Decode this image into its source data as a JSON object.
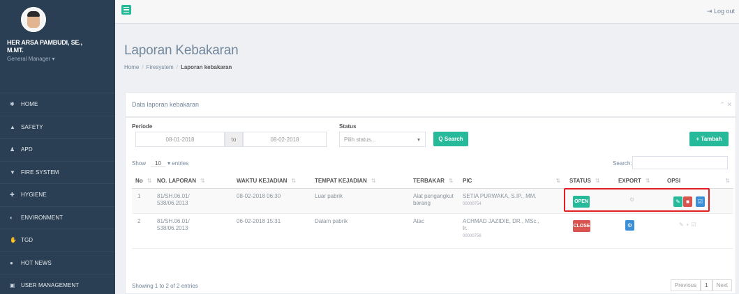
{
  "user": {
    "name_line1": "HER ARSA PAMBUDI, SE.,",
    "name_line2": "M.MT.",
    "role": "General Manager ▾"
  },
  "sidebar": {
    "items": [
      {
        "label": "Home",
        "icon": "home-icon",
        "glyph": "✱"
      },
      {
        "label": "SAFETY",
        "icon": "thumbs-up-icon",
        "glyph": "▲"
      },
      {
        "label": "APD",
        "icon": "user-icon",
        "glyph": "♟"
      },
      {
        "label": "FIRE SYSTEM",
        "icon": "fire-extinguisher-icon",
        "glyph": "▼"
      },
      {
        "label": "HYGIENE",
        "icon": "plus-icon",
        "glyph": "✚"
      },
      {
        "label": "ENVIRONMENT",
        "icon": "leaf-icon",
        "glyph": "◐"
      },
      {
        "label": "TGD",
        "icon": "hands-icon",
        "glyph": "✋"
      },
      {
        "label": "HOT NEWS",
        "icon": "globe-icon",
        "glyph": "●"
      },
      {
        "label": "USER MANAGEMENT",
        "icon": "lock-icon",
        "glyph": "▣"
      }
    ]
  },
  "topbar": {
    "logout": "Log out",
    "logout_glyph": "⇥"
  },
  "page": {
    "title": "Laporan Kebakaran",
    "breadcrumb": [
      "Home",
      "Firesystem",
      "Laporan kebakaran"
    ]
  },
  "panel": {
    "title": "Data laporan kebakaran",
    "tools": "⌃ ✕"
  },
  "filters": {
    "periode_label": "Periode",
    "date_from": "08-01-2018",
    "to_label": "to",
    "date_to": "08-02-2018",
    "status_label": "Status",
    "status_placeholder": "Pilih status...",
    "search_button": "Q Search",
    "add_button": "+ Tambah"
  },
  "table_controls": {
    "show_label": "Show",
    "show_value": "10",
    "entries_label": "▾ entries",
    "search_label": "Search:"
  },
  "table": {
    "headers": [
      "No",
      "NO. LAPORAN",
      "WAKTU KEJADIAN",
      "TEMPAT KEJADIAN",
      "TERBAKAR",
      "PIC",
      "STATUS",
      "EXPORT",
      "OPSI"
    ],
    "rows": [
      {
        "no": "1",
        "laporan_1": "81/SH.06.01/",
        "laporan_2": "538/06.2013",
        "waktu": "08-02-2018 06:30",
        "tempat": "Luar pabrik",
        "terbakar_1": "Alat pengangkut",
        "terbakar_2": "barang",
        "pic_1": "SETIA PURWAKA, S.IP., MM.",
        "pic_2": "",
        "pic_id": "00000754",
        "status": "OPEN",
        "status_color": "#26b99a"
      },
      {
        "no": "2",
        "laporan_1": "81/SH.06.01/",
        "laporan_2": "538/06.2013",
        "waktu": "06-02-2018 15:31",
        "tempat": "Dalam pabrik",
        "terbakar_1": "Atac",
        "terbakar_2": "",
        "pic_1": "ACHMAD JAZIDIE, DR., MSc.,",
        "pic_2": "Ir.",
        "pic_id": "00000756",
        "status": "CLOSE",
        "status_color": "#d9534f"
      }
    ]
  },
  "footer": {
    "info": "Showing 1 to 2 of 2 entries",
    "prev": "Previous",
    "page": "1",
    "next": "Next"
  },
  "colors": {
    "green": "#26b99a",
    "red": "#d9534f",
    "blue": "#3a8fd6",
    "highlight": "#e02020",
    "sidebar": "#2a3f54"
  }
}
